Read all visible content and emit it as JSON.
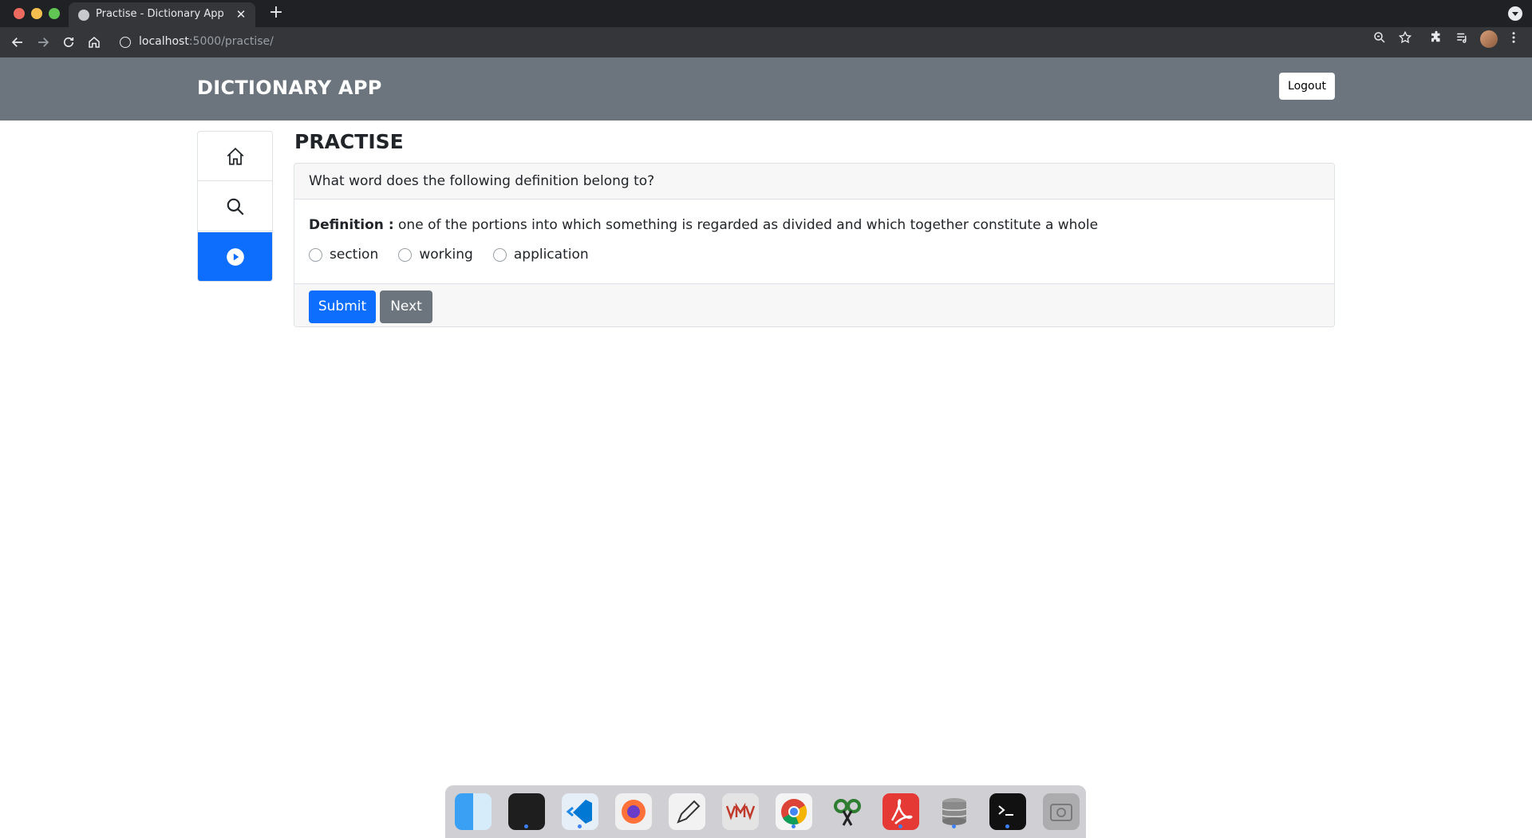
{
  "browser": {
    "tab_title": "Practise - Dictionary App",
    "url_host": "localhost",
    "url_path": ":5000/practise/"
  },
  "navbar": {
    "brand": "DICTIONARY APP",
    "logout_label": "Logout"
  },
  "sidebar": {
    "items": [
      {
        "icon": "home-icon",
        "active": false
      },
      {
        "icon": "search-icon",
        "active": false
      },
      {
        "icon": "play-circle-icon",
        "active": true
      }
    ]
  },
  "main": {
    "title": "PRACTISE",
    "question": "What word does the following definition belong to?",
    "definition_label": "Definition :",
    "definition_text": "one of the portions into which something is regarded as divided and which together constitute a whole",
    "options": [
      "section",
      "working",
      "application"
    ],
    "submit_label": "Submit",
    "next_label": "Next"
  },
  "dock": {
    "apps": [
      "finder-icon",
      "terminal-icon",
      "vscode-icon",
      "firefox-icon",
      "text-editor-icon",
      "vmware-icon",
      "chrome-icon",
      "gnome-tweaks-icon",
      "acrobat-icon",
      "database-icon",
      "console-icon",
      "screenshot-icon"
    ]
  },
  "colors": {
    "navbar_bg": "#6c757d",
    "primary": "#0d6efd",
    "secondary": "#6c757d"
  }
}
